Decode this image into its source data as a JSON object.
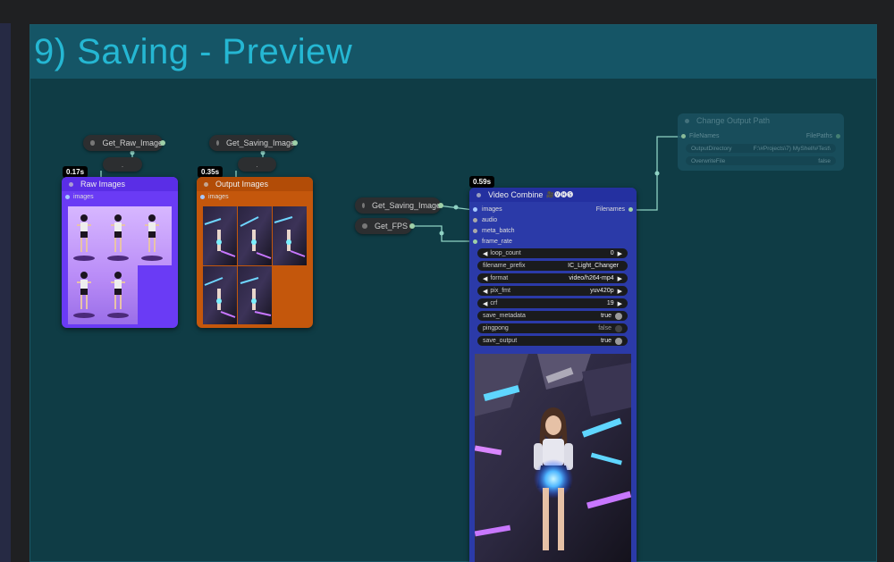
{
  "group": {
    "title": "9) Saving - Preview"
  },
  "get_raw_image": {
    "label": "Get_Raw_Image"
  },
  "get_saving_image_top": {
    "label": "Get_Saving_Image"
  },
  "get_saving_image": {
    "label": "Get_Saving_Image"
  },
  "get_fps": {
    "label": "Get_FPS"
  },
  "reroute_dots": ".",
  "raw_images": {
    "title": "Raw Images",
    "port": "images",
    "time": "0.17s"
  },
  "output_images": {
    "title": "Output Images",
    "port": "images",
    "time": "0.35s"
  },
  "video_combine": {
    "title": "Video Combine",
    "title_icons": "🎥🅥🅗🅢",
    "time": "0.59s",
    "inputs": [
      "images",
      "audio",
      "meta_batch",
      "frame_rate"
    ],
    "output": "Filenames",
    "widgets": {
      "loop_count": {
        "label": "loop_count",
        "value": "0"
      },
      "filename_prefix": {
        "label": "filename_prefix",
        "value": "IC_Light_Changer"
      },
      "format": {
        "label": "format",
        "value": "video/h264-mp4"
      },
      "pix_fmt": {
        "label": "pix_fmt",
        "value": "yuv420p"
      },
      "crf": {
        "label": "crf",
        "value": "19"
      },
      "save_metadata": {
        "label": "save_metadata",
        "value": "true"
      },
      "pingpong": {
        "label": "pingpong",
        "value": "false"
      },
      "save_output": {
        "label": "save_output",
        "value": "true"
      }
    }
  },
  "change_output_path": {
    "title": "Change Output Path",
    "input": "FileNames",
    "output": "FilePaths",
    "output_directory_label": "OutputDirectory",
    "output_directory_value": "F:\\#Projects\\7) MyShell\\#Test\\",
    "overwrite_label": "OverwriteFile",
    "overwrite_value": "false"
  },
  "colors": {
    "raw_images_bg": "#6a3bf5",
    "output_images_bg": "#c4570c",
    "video_combine_bg": "#2b3aa8",
    "group_bg": "#0f3c45",
    "group_title": "#25b7d3",
    "wire": "#8fd2c4"
  }
}
